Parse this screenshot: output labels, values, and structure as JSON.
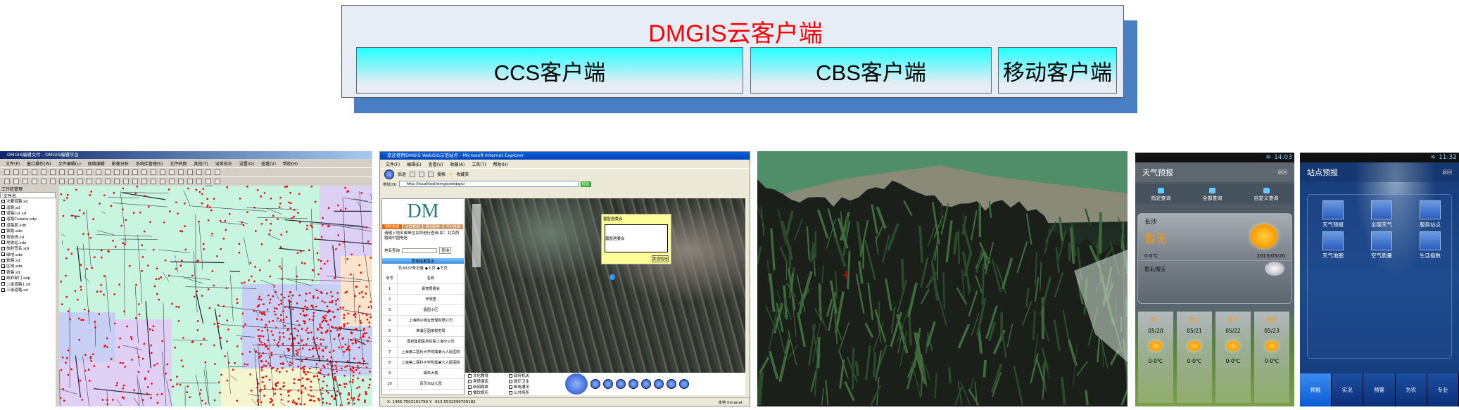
{
  "diagram": {
    "title": "DMGIS云客户端",
    "clients": [
      "CCS客户端",
      "CBS客户端",
      "移动客户端"
    ],
    "colors": {
      "title": "#ff0000",
      "shadow": "#4a7ec4",
      "box": "#e6edf7",
      "client_gradient_top": "#22ffff"
    }
  },
  "ccs": {
    "window_title": "DMGIS编辑文件 - DMGIS编辑平台",
    "menu": [
      "文件(F)",
      "窗口操作(W)",
      "文件编辑(L)",
      "网络编辑",
      "影像分析",
      "系统库管理(S)",
      "文件转换",
      "其他(T)",
      "误差校正",
      "设置(O)",
      "查看(V)",
      "帮助(H)"
    ],
    "panel_title": "工作区管理",
    "col_file": "文件名",
    "layers": [
      "次要道路.sd",
      "道路.sd",
      "道路cut.sd",
      "道路Cubata.sdp",
      "道路层.sdh",
      "铁路.sdo",
      "地铁线.sd",
      "地铁站.sdo",
      "放射签名.sdi",
      "绿地.sda",
      "铁路.sd",
      "区域.sda",
      "铁路.sd",
      "政府部门.sdp",
      "二级道路1.sd",
      "三级道路.sd"
    ]
  },
  "cbs": {
    "window_title": "欢迎使用DMGIS WebGIS示范站点 - Microsoft Internet Explorer",
    "menu": [
      "文件(F)",
      "编辑(E)",
      "查看(V)",
      "收藏(A)",
      "工具(T)",
      "帮助(H)"
    ],
    "toolbar": {
      "back": "后退",
      "search": "搜索",
      "favorites": "收藏夹",
      "go": "转到",
      "address_label": "地址(D)"
    },
    "address": "http://localhost/dmgis/webgis/",
    "logo": "DM",
    "tabs": [
      "地址查询",
      "公交查询",
      "周边服务",
      "行业查询"
    ],
    "hint": "请输入地名或单位名称进行查询 如：北京西路或中国电信",
    "search_label": "地名查询",
    "search_button": "查询",
    "results_title": "查询结果显示",
    "results_pager": "共3037条记录 ◆上页 ◆下页",
    "col_no": "序号",
    "col_name": "名称",
    "results": [
      [
        "1",
        "嘉智居委会"
      ],
      [
        "2",
        "开明里"
      ],
      [
        "3",
        "晋园小区"
      ],
      [
        "4",
        "上海新兴物业管理有限公司"
      ],
      [
        "5",
        "黄浦区国家税务局"
      ],
      [
        "6",
        "国药集团医药控股上海分公司"
      ],
      [
        "7",
        "上海第二医科大学附属第九人民医院"
      ],
      [
        "8",
        "上海第二医科大学附属第九人民医院"
      ],
      [
        "9",
        "钢琴大楼"
      ],
      [
        "10",
        "百灵鸟幼儿园"
      ]
    ],
    "popup_title": "嘉智居委会",
    "popup_text": "嘉智居委会",
    "popup_button": "发送短信",
    "categories": [
      "文化教育",
      "政府机关",
      "宾馆酒店",
      "医疗卫生",
      "新闻媒体",
      "邮电通讯",
      "餐饮娱乐",
      "公共场所"
    ],
    "status_coords": "X: 1466.7503191799 Y: -913.5532599709182",
    "status_zone": "本地 Intranet"
  },
  "mobile1": {
    "time": "14:03",
    "title": "天气预报",
    "back": "返回",
    "queries": [
      "指定查询",
      "全部查询",
      "自定义查询"
    ],
    "city": "长沙",
    "weather": "暂无",
    "temp": "0-0℃",
    "date": "2013/05/20",
    "wind": "暂无/暂无",
    "forecast": [
      {
        "day": "周一",
        "date": "05/20",
        "temp": "0-0℃"
      },
      {
        "day": "周二",
        "date": "05/21",
        "temp": "0-0℃"
      },
      {
        "day": "周三",
        "date": "05/22",
        "temp": "0-0℃"
      },
      {
        "day": "周四",
        "date": "05/23",
        "temp": "0-0℃"
      }
    ]
  },
  "mobile2": {
    "time": "11:32",
    "title": "站点预报",
    "back": "返回",
    "icons": [
      "天气预报",
      "全国天气",
      "服务站点",
      "天气地图",
      "空气质量",
      "生活指数"
    ],
    "tabs": [
      "预报",
      "实况",
      "预警",
      "为农",
      "专业"
    ]
  }
}
